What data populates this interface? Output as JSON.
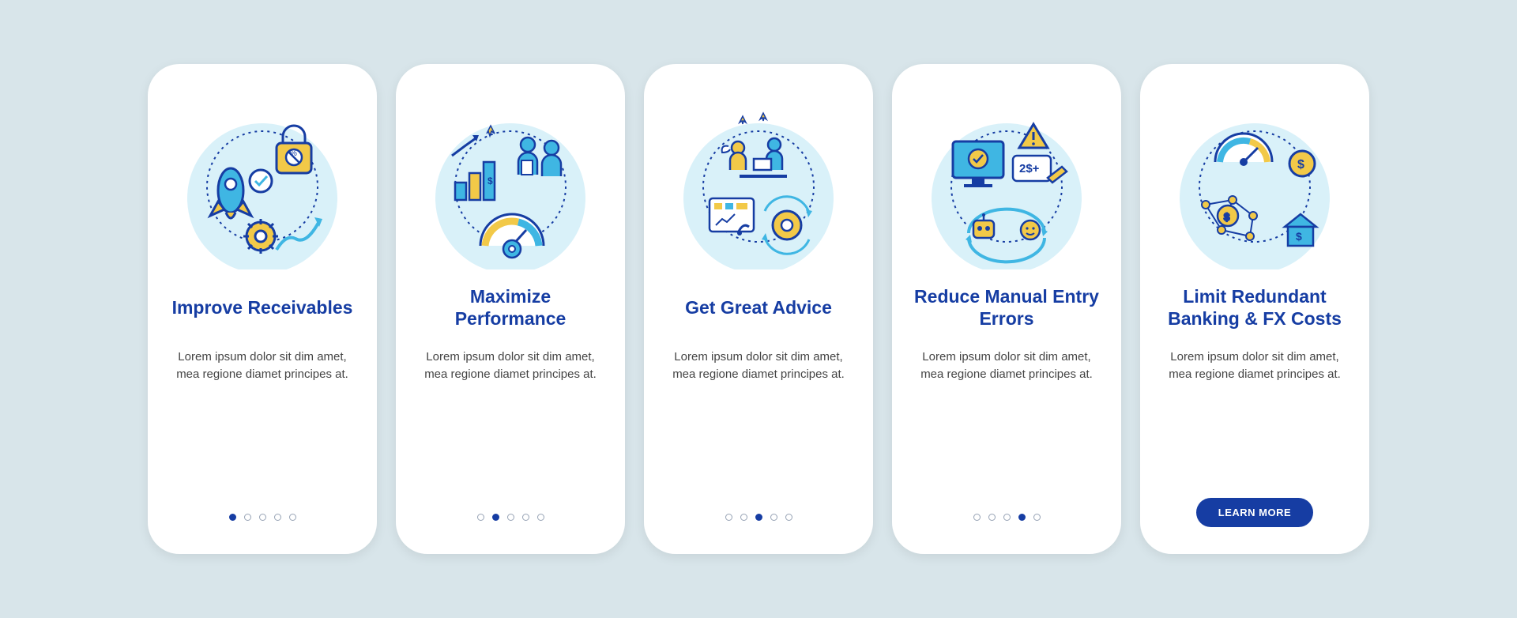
{
  "cta_label": "LEARN MORE",
  "lorem": "Lorem ipsum dolor sit dim amet, mea regione diamet principes at.",
  "cards": [
    {
      "title": "Improve Receivables"
    },
    {
      "title": "Maximize Performance"
    },
    {
      "title": "Get Great Advice"
    },
    {
      "title": "Reduce Manual Entry Errors"
    },
    {
      "title": "Limit Redundant Banking & FX Costs"
    }
  ],
  "colors": {
    "navy": "#163da3",
    "yellow": "#f2c948",
    "sky": "#3fb6e3",
    "skylight": "#bfe9f5",
    "white": "#ffffff"
  }
}
